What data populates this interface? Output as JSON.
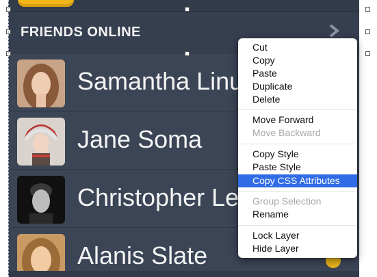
{
  "header": {
    "title": "FRIENDS ONLINE"
  },
  "friends": [
    {
      "name": "Samantha Linu"
    },
    {
      "name": "Jane Soma"
    },
    {
      "name": "Christopher Lec"
    },
    {
      "name": "Alanis Slate"
    }
  ],
  "context_menu": {
    "groups": [
      [
        {
          "label": "Cut",
          "enabled": true
        },
        {
          "label": "Copy",
          "enabled": true
        },
        {
          "label": "Paste",
          "enabled": true
        },
        {
          "label": "Duplicate",
          "enabled": true
        },
        {
          "label": "Delete",
          "enabled": true
        }
      ],
      [
        {
          "label": "Move Forward",
          "enabled": true
        },
        {
          "label": "Move Backward",
          "enabled": false
        }
      ],
      [
        {
          "label": "Copy Style",
          "enabled": true
        },
        {
          "label": "Paste Style",
          "enabled": true
        },
        {
          "label": "Copy CSS Attributes",
          "enabled": true,
          "highlighted": true
        }
      ],
      [
        {
          "label": "Group Selection",
          "enabled": false
        },
        {
          "label": "Rename",
          "enabled": true
        }
      ],
      [
        {
          "label": "Lock Layer",
          "enabled": true
        },
        {
          "label": "Hide Layer",
          "enabled": true
        }
      ]
    ]
  },
  "icons": {
    "chevron": "chevron-right-icon",
    "status": "online-status-dot"
  },
  "colors": {
    "panel_bg": "#3b4556",
    "accent_yellow": "#e9b41c",
    "menu_highlight": "#2f6ce5"
  }
}
